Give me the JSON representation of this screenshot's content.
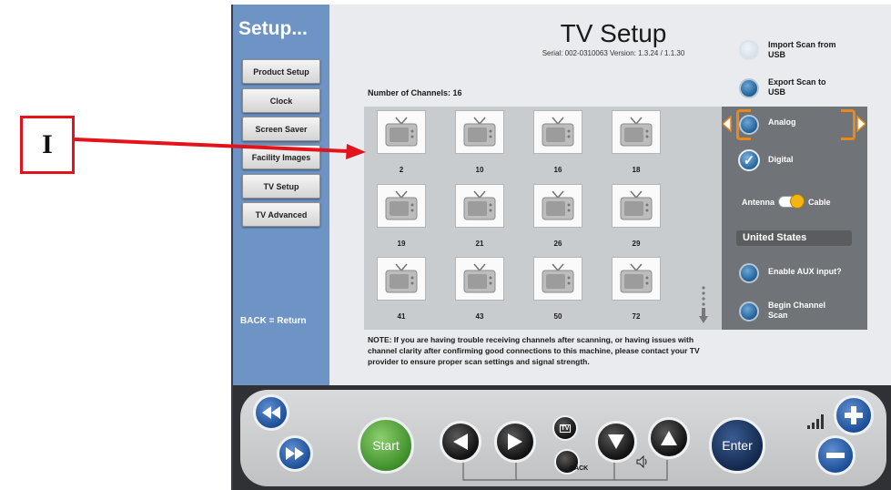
{
  "annotation": {
    "label": "I"
  },
  "sidebar": {
    "title": "Setup...",
    "items": [
      {
        "label": "Product Setup"
      },
      {
        "label": "Clock"
      },
      {
        "label": "Screen Saver"
      },
      {
        "label": "Facility Images"
      },
      {
        "label": "TV Setup"
      },
      {
        "label": "TV Advanced"
      }
    ],
    "back_hint": "BACK = Return"
  },
  "header": {
    "title": "TV Setup",
    "serial": "Serial: 002-0310063  Version: 1.3.24 / 1.1.30"
  },
  "channels": {
    "count_label": "Number of Channels: 16",
    "items": [
      "2",
      "10",
      "16",
      "18",
      "19",
      "21",
      "26",
      "29",
      "41",
      "43",
      "50",
      "72"
    ]
  },
  "options": {
    "import_scan": "Import Scan from USB",
    "export_scan": "Export Scan to USB",
    "analog": "Analog",
    "digital": "Digital",
    "antenna": "Antenna",
    "cable": "Cable",
    "country": "United States",
    "enable_aux": "Enable AUX input?",
    "begin_scan": "Begin Channel Scan"
  },
  "note": "NOTE: If you are having trouble receiving channels after scanning, or having issues with channel clarity after confirming good connections to this machine, please contact your TV provider to ensure proper scan settings and signal strength.",
  "remote": {
    "start": "Start",
    "enter": "Enter",
    "back": "BACK",
    "tv": "TV"
  },
  "colors": {
    "sidebar": "#6d94c5",
    "accent_orange": "#e8891b",
    "start_green": "#3f8f2b",
    "button_blue": "#1d4f98",
    "annotation_red": "#e3131b"
  }
}
